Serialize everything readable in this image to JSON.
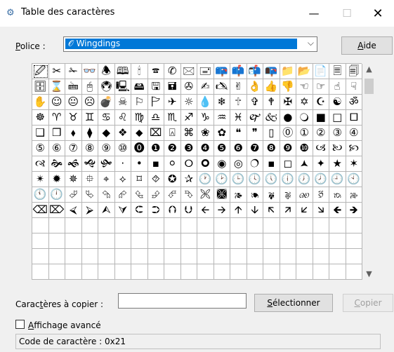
{
  "window": {
    "title": "Table des caractères",
    "app_icon": "charmap-icon",
    "min_glyph": "—",
    "max_glyph": "☐",
    "close_glyph": "✕"
  },
  "police": {
    "label_underlined": "P",
    "label_rest": "olice :",
    "font_selected": "Wingdings",
    "font_icon": "font-icon",
    "arrow": "⌵"
  },
  "aide_button": {
    "label_underlined": "A",
    "label_rest": "ide"
  },
  "grid": {
    "rows": [
      [
        "🖉",
        "✂",
        "✁",
        "👓",
        "🕭",
        "🕮",
        "🕯",
        "🕿",
        "✆",
        "🖂",
        "🖃",
        "📪",
        "📫",
        "📬",
        "📭",
        "📁",
        "📂",
        "📄",
        "🗏",
        "🗐"
      ],
      [
        "🗄",
        "⌛",
        "🖮",
        "🖰",
        "🖲",
        "🖳",
        "🖴",
        "🖫",
        "🖬",
        "✇",
        "✍",
        "🖎",
        "✌",
        "👌",
        "👍",
        "👎",
        "☜",
        "☞",
        "☝",
        "☟"
      ],
      [
        "✋",
        "☺",
        "😐",
        "☹",
        "💣",
        "☠",
        "⚐",
        "🏱",
        "✈",
        "☼",
        "💧",
        "❄",
        "🕆",
        "✞",
        "🕈",
        "✠",
        "✡",
        "☪",
        "☯",
        "ॐ"
      ],
      [
        "☸",
        "♈",
        "♉",
        "♊",
        "♋",
        "♌",
        "♍",
        "♎",
        "♏",
        "♐",
        "♑",
        "♒",
        "♓",
        "🙰",
        "🙵",
        "●",
        "🔾",
        "■",
        "□",
        "🞐"
      ],
      [
        "❑",
        "❒",
        "⬧",
        "⧫",
        "◆",
        "❖",
        "⬥",
        "⌧",
        "⍓",
        "⌘",
        "❀",
        "✿",
        "❝",
        "❞",
        "▯",
        "⓪",
        "①",
        "②",
        "③",
        "④"
      ],
      [
        "⑤",
        "⑥",
        "⑦",
        "⑧",
        "⑨",
        "⑩",
        "⓿",
        "❶",
        "❷",
        "❸",
        "❹",
        "❺",
        "❻",
        "❼",
        "❽",
        "❾",
        "❿",
        "🙢",
        "🙠",
        "🙡"
      ],
      [
        "🙣",
        "🙞",
        "🙜",
        "🙝",
        "🙟",
        "·",
        "•",
        "▪",
        "⚪",
        "🞆",
        "🞈",
        "◉",
        "◎",
        "🔿",
        "▪",
        "◻",
        "🟂",
        "✦",
        "★",
        "✶"
      ],
      [
        "✴",
        "✹",
        "✵",
        "⯐",
        "⌖",
        "⟡",
        "⌑",
        "⯑",
        "✪",
        "✰",
        "🕐",
        "🕑",
        "🕒",
        "🕓",
        "🕔",
        "🕕",
        "🕖",
        "🕗",
        "🕘",
        "🕙"
      ],
      [
        "🕚",
        "🕛",
        "⮰",
        "⮱",
        "⮲",
        "⮳",
        "⮴",
        "⮵",
        "⮶",
        "⮷",
        "🙪",
        "🙫",
        "🙕",
        "🙔",
        "🙗",
        "🙖",
        "🙐",
        "🙑",
        "🙒",
        "🙓"
      ],
      [
        "⌫",
        "⌦",
        "⮘",
        "⮚",
        "⮙",
        "⮛",
        "⮈",
        "⮊",
        "⮉",
        "⮋",
        "🡨",
        "🡪",
        "🡩",
        "🡫",
        "🡬",
        "🡭",
        "🡯",
        "🡮",
        "🡸",
        "🡺"
      ]
    ]
  },
  "scrollbar": {
    "up": "▲",
    "down": "▼"
  },
  "copy": {
    "label_pre": "Carac",
    "label_underlined": "t",
    "label_post": "ères à copier :",
    "input_value": ""
  },
  "select_button": {
    "label_underlined": "S",
    "label_rest": "électionner"
  },
  "copy_button": {
    "label_underlined": "C",
    "label_rest": "opier"
  },
  "advanced": {
    "label_underlined": "A",
    "label_rest": "ffichage avancé"
  },
  "status": {
    "text": "Code de caractère : 0x21"
  }
}
